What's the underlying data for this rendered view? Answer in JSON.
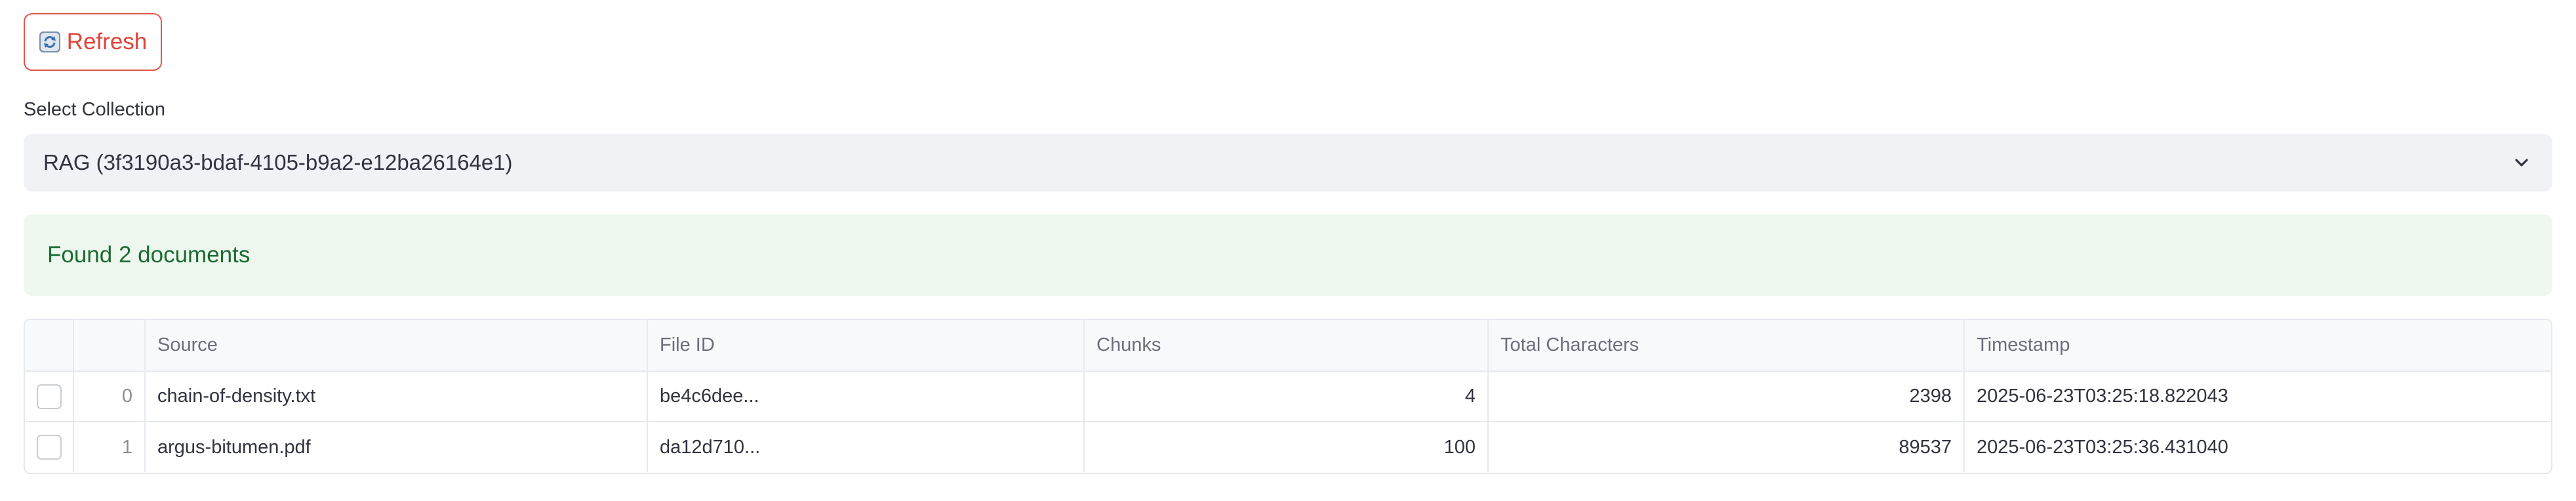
{
  "toolbar": {
    "refresh_label": "Refresh",
    "refresh_icon": "refresh-icon"
  },
  "collection_select": {
    "label": "Select Collection",
    "selected_value": "RAG (3f3190a3-bdaf-4105-b9a2-e12ba26164e1)",
    "icon": "chevron-down-icon"
  },
  "status": {
    "message": "Found 2 documents",
    "color": "#1b6b32",
    "background": "#eef7ee"
  },
  "table": {
    "columns": [
      "",
      "",
      "Source",
      "File ID",
      "Chunks",
      "Total Characters",
      "Timestamp"
    ],
    "rows": [
      {
        "index": "0",
        "source": "chain-of-density.txt",
        "file_id": "be4c6dee...",
        "chunks": "4",
        "total_characters": "2398",
        "timestamp": "2025-06-23T03:25:18.822043"
      },
      {
        "index": "1",
        "source": "argus-bitumen.pdf",
        "file_id": "da12d710...",
        "chunks": "100",
        "total_characters": "89537",
        "timestamp": "2025-06-23T03:25:36.431040"
      }
    ]
  },
  "colors": {
    "accent": "#e0443a",
    "select_bg": "#f0f2f6",
    "table_border": "#e6e9ef"
  }
}
